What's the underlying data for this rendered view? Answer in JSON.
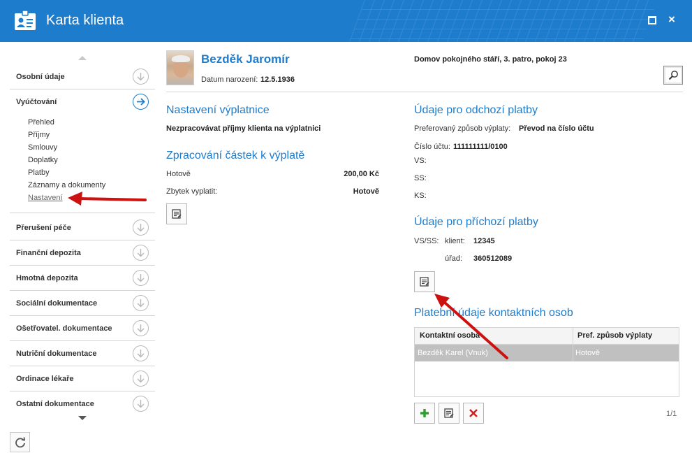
{
  "window": {
    "title": "Karta klienta",
    "app_icon": "contact-card-icon",
    "controls": {
      "maximize": "maximize-icon",
      "close": "×"
    }
  },
  "sidebar": {
    "sections": [
      {
        "label": "Osobní údaje",
        "icon": "chevron-circle-down-icon"
      },
      {
        "label": "Vyúčtování",
        "icon": "arrow-circle-right-icon",
        "active": true
      },
      {
        "label": "Přerušení péče",
        "icon": "chevron-circle-down-icon"
      },
      {
        "label": "Finanční depozita",
        "icon": "chevron-circle-down-icon"
      },
      {
        "label": "Hmotná depozita",
        "icon": "chevron-circle-down-icon"
      },
      {
        "label": "Sociální dokumentace",
        "icon": "chevron-circle-down-icon"
      },
      {
        "label": "Ošetřovatel. dokumentace",
        "icon": "chevron-circle-down-icon"
      },
      {
        "label": "Nutriční dokumentace",
        "icon": "chevron-circle-down-icon"
      },
      {
        "label": "Ordinace lékaře",
        "icon": "chevron-circle-down-icon"
      },
      {
        "label": "Ostatní dokumentace",
        "icon": "chevron-circle-down-icon"
      }
    ],
    "subitems": [
      "Přehled",
      "Příjmy",
      "Smlouvy",
      "Doplatky",
      "Platby",
      "Záznamy a dokumenty",
      "Nastavení"
    ],
    "current_subitem": "Nastavení",
    "accent": "#1e7ccc"
  },
  "client": {
    "name": "Bezděk Jaromír",
    "dob_label": "Datum narození:",
    "dob": "12.5.1936",
    "address": "Domov pokojného stáří, 3. patro, pokoj 23"
  },
  "payout": {
    "heading": "Nastavení výplatnice",
    "note": "Nezpracovávat příjmy klienta na výplatnici"
  },
  "processing": {
    "heading": "Zpracování částek k výplatě",
    "rows": [
      {
        "label": "Hotově",
        "value": "200,00 Kč"
      },
      {
        "label": "Zbytek vyplatit:",
        "value": "Hotově"
      }
    ]
  },
  "outgoing": {
    "heading": "Údaje pro odchozí platby",
    "preferred_label": "Preferovaný způsob výplaty:",
    "preferred_value": "Převod na číslo účtu",
    "account_label": "Číslo účtu:",
    "account_value": "111111111/0100",
    "vs_label": "VS:",
    "ss_label": "SS:",
    "ks_label": "KS:"
  },
  "incoming": {
    "heading": "Údaje pro příchozí platby",
    "vsss_label": "VS/SS:",
    "client_label": "klient:",
    "client_value": "12345",
    "office_label": "úřad:",
    "office_value": "360512089"
  },
  "contacts": {
    "heading": "Platební údaje kontaktních osob",
    "columns": [
      "Kontaktní osoba",
      "Pref. způsob výplaty"
    ],
    "rows": [
      {
        "person": "Bezděk Karel (Vnuk)",
        "method": "Hotově"
      }
    ],
    "pagination": "1/1"
  },
  "colors": {
    "title_bar": "#1e7ccc",
    "heading": "#1e7ccc",
    "annotation_arrow": "#cc1111",
    "add": "#2e9e2e",
    "delete": "#d42020"
  }
}
